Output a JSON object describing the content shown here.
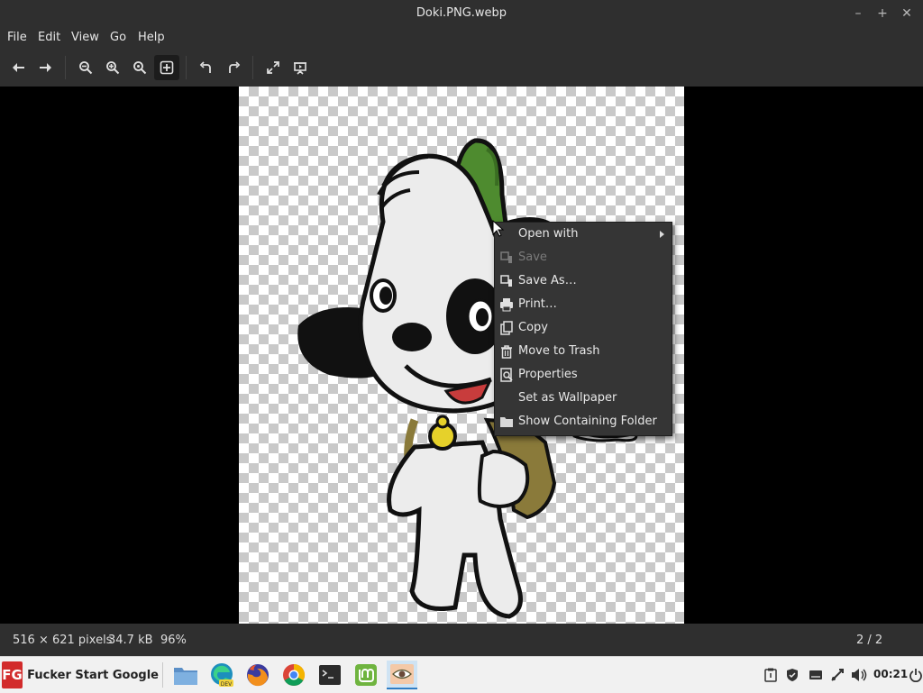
{
  "window": {
    "title": "Doki.PNG.webp"
  },
  "menu": [
    "File",
    "Edit",
    "View",
    "Go",
    "Help"
  ],
  "toolbar_icons": [
    "previous-icon",
    "next-icon",
    "zoom-out-icon",
    "zoom-in-icon",
    "zoom-normal-icon",
    "zoom-fit-icon",
    "rotate-left-icon",
    "rotate-right-icon",
    "fullscreen-icon",
    "slideshow-icon"
  ],
  "context_menu": {
    "open_with": "Open with",
    "save": "Save",
    "save_as": "Save As…",
    "print": "Print…",
    "copy": "Copy",
    "move_to_trash": "Move to Trash",
    "properties": "Properties",
    "set_wallpaper": "Set as Wallpaper",
    "show_folder": "Show Containing Folder"
  },
  "status": {
    "dimensions": "516 × 621 pixels",
    "size": "34.7 kB",
    "zoom": "96%",
    "position": "2 / 2"
  },
  "taskbar": {
    "start_logo": "FG",
    "start_label": "Fucker Start Google",
    "apps": [
      "file-manager",
      "edge-dev",
      "firefox",
      "chrome",
      "terminal",
      "mint-update",
      "image-viewer"
    ],
    "clock": "00:21"
  },
  "colors": {
    "dog_green": "#4e8b2f",
    "menu_bg": "#353535",
    "titlebar": "#2f2f2f"
  }
}
